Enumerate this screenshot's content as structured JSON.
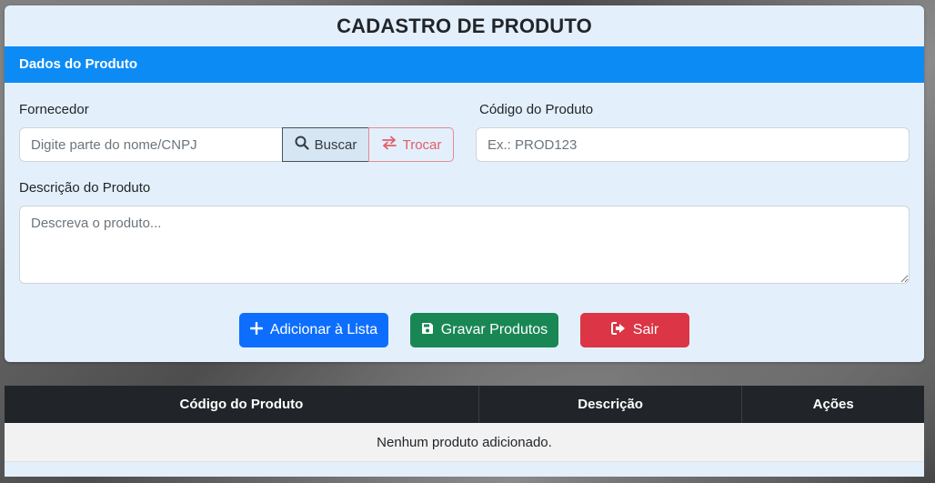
{
  "page": {
    "title": "CADASTRO DE PRODUTO",
    "section_title": "Dados do Produto"
  },
  "form": {
    "fornecedor": {
      "label": "Fornecedor",
      "placeholder": "Digite parte do nome/CNPJ",
      "value": "",
      "search_button": "Buscar",
      "swap_button": "Trocar"
    },
    "codigo": {
      "label": "Código do Produto",
      "placeholder": "Ex.: PROD123",
      "value": ""
    },
    "descricao": {
      "label": "Descrição do Produto",
      "placeholder": "Descreva o produto...",
      "value": ""
    }
  },
  "actions": {
    "add_label": "Adicionar à Lista",
    "save_label": "Gravar Produtos",
    "exit_label": "Sair"
  },
  "colors": {
    "primary": "#0d6efd",
    "success": "#198754",
    "danger": "#dc3545",
    "header_blue": "#0d8bf5"
  },
  "table": {
    "columns": [
      "Código do Produto",
      "Descrição",
      "Ações"
    ],
    "empty_message": "Nenhum produto adicionado."
  }
}
